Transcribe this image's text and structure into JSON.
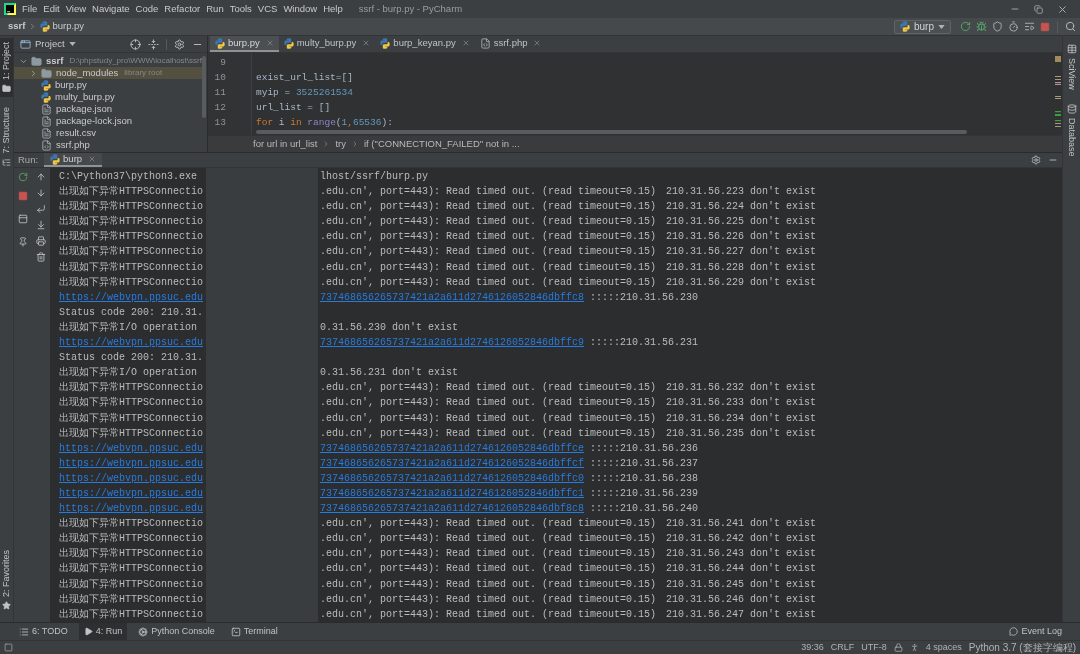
{
  "window": {
    "title": "ssrf - burp.py - PyCharm"
  },
  "menu": [
    "File",
    "Edit",
    "View",
    "Navigate",
    "Code",
    "Refactor",
    "Run",
    "Tools",
    "VCS",
    "Window",
    "Help"
  ],
  "navigation_bar": {
    "breadcrumbs": [
      {
        "label": "ssrf",
        "kind": "project"
      },
      {
        "label": "burp.py",
        "kind": "python"
      }
    ],
    "run_configuration": {
      "label": "burp",
      "kind": "python"
    }
  },
  "left_stripe": {
    "top": [
      {
        "label": "1: Project",
        "kind": "project",
        "selected": true
      },
      {
        "label": "7: Structure",
        "kind": "structure",
        "selected": false
      }
    ],
    "bottom": [
      {
        "label": "2: Favorites",
        "kind": "favorites",
        "selected": false
      }
    ]
  },
  "right_stripe": [
    {
      "label": "SciView",
      "kind": "sciview"
    },
    {
      "label": "Database",
      "kind": "database"
    }
  ],
  "project_panel": {
    "title": "Project",
    "tree": [
      {
        "label": "ssrf",
        "hint": "D:\\phpstudy_pro\\WWW\\localhost\\ssrf",
        "kind": "folder",
        "expanded": true,
        "selected": false,
        "children": [
          {
            "label": "node_modules",
            "hint": "library root",
            "kind": "folder",
            "expanded": false,
            "selected": true
          },
          {
            "label": "burp.py",
            "kind": "python",
            "selected": false
          },
          {
            "label": "multy_burp.py",
            "kind": "python",
            "selected": false
          },
          {
            "label": "package.json",
            "kind": "json",
            "selected": false
          },
          {
            "label": "package-lock.json",
            "kind": "json",
            "selected": false
          },
          {
            "label": "result.csv",
            "kind": "csv",
            "selected": false
          },
          {
            "label": "ssrf.php",
            "kind": "php",
            "selected": false
          }
        ]
      }
    ]
  },
  "editor": {
    "tabs": [
      {
        "label": "burp.py",
        "kind": "python",
        "selected": true
      },
      {
        "label": "multy_burp.py",
        "kind": "python",
        "selected": false
      },
      {
        "label": "burp_keyan.py",
        "kind": "python",
        "selected": false
      },
      {
        "label": "ssrf.php",
        "kind": "php",
        "selected": false
      }
    ],
    "lines": [
      {
        "number": "9"
      },
      {
        "number": "10",
        "tokens": [
          {
            "text": "exist_url_list=[]",
            "kind": "plain"
          }
        ]
      },
      {
        "number": "11",
        "tokens": [
          {
            "text": "myip = ",
            "kind": "plain"
          },
          {
            "text": "3525261534",
            "kind": "number"
          }
        ]
      },
      {
        "number": "12",
        "tokens": [
          {
            "text": "url_list = []",
            "kind": "plain"
          }
        ]
      },
      {
        "number": "13",
        "tokens": [
          {
            "text": "for",
            "kind": "keyword"
          },
          {
            "text": " i ",
            "kind": "plain"
          },
          {
            "text": "in",
            "kind": "keyword"
          },
          {
            "text": " range",
            "kind": "builtin"
          },
          {
            "text": "(",
            "kind": "plain"
          },
          {
            "text": "1",
            "kind": "number"
          },
          {
            "text": ",",
            "kind": "operator"
          },
          {
            "text": "65536",
            "kind": "number"
          },
          {
            "text": "):",
            "kind": "plain"
          }
        ]
      }
    ],
    "breadcrumbs": [
      "for url in url_list",
      "try",
      "if (\"CONNECTION_FAILED\" not in ..."
    ]
  },
  "run_panel": {
    "label": "Run:",
    "tabs": [
      {
        "label": "burp",
        "kind": "python",
        "selected": true
      }
    ],
    "console": [
      {
        "kind": "command",
        "left": "C:\\Python37\\python3.exe",
        "right": "lhost/ssrf/burp.py"
      },
      {
        "kind": "exception",
        "left": "出现如下异常HTTPSConnectio",
        "right": ".edu.cn', port=443): Read timed out. (read timeout=0.15)",
        "result": "210.31.56.223 don't exist"
      },
      {
        "kind": "exception",
        "left": "出现如下异常HTTPSConnectio",
        "right": ".edu.cn', port=443): Read timed out. (read timeout=0.15)",
        "result": "210.31.56.224 don't exist"
      },
      {
        "kind": "exception",
        "left": "出现如下异常HTTPSConnectio",
        "right": ".edu.cn', port=443): Read timed out. (read timeout=0.15)",
        "result": "210.31.56.225 don't exist"
      },
      {
        "kind": "exception",
        "left": "出现如下异常HTTPSConnectio",
        "right": ".edu.cn', port=443): Read timed out. (read timeout=0.15)",
        "result": "210.31.56.226 don't exist"
      },
      {
        "kind": "exception",
        "left": "出现如下异常HTTPSConnectio",
        "right": ".edu.cn', port=443): Read timed out. (read timeout=0.15)",
        "result": "210.31.56.227 don't exist"
      },
      {
        "kind": "exception",
        "left": "出现如下异常HTTPSConnectio",
        "right": ".edu.cn', port=443): Read timed out. (read timeout=0.15)",
        "result": "210.31.56.228 don't exist"
      },
      {
        "kind": "exception",
        "left": "出现如下异常HTTPSConnectio",
        "right": ".edu.cn', port=443): Read timed out. (read timeout=0.15)",
        "result": "210.31.56.229 don't exist"
      },
      {
        "kind": "link",
        "left": "https://webvpn.ppsuc.edu",
        "right": "737468656265737421a2a611d2746126052846dbffc8",
        "result": ":::::210.31.56.230"
      },
      {
        "kind": "status",
        "left": "Status code 200: 210.31."
      },
      {
        "kind": "io_error",
        "left": "出现如下异常I/O operation",
        "right": "0.31.56.230 don't exist"
      },
      {
        "kind": "link",
        "left": "https://webvpn.ppsuc.edu",
        "right": "737468656265737421a2a611d2746126052846dbffc9",
        "result": ":::::210.31.56.231"
      },
      {
        "kind": "status",
        "left": "Status code 200: 210.31."
      },
      {
        "kind": "io_error",
        "left": "出现如下异常I/O operation",
        "right": "0.31.56.231 don't exist"
      },
      {
        "kind": "exception",
        "left": "出现如下异常HTTPSConnectio",
        "right": ".edu.cn', port=443): Read timed out. (read timeout=0.15)",
        "result": "210.31.56.232 don't exist"
      },
      {
        "kind": "exception",
        "left": "出现如下异常HTTPSConnectio",
        "right": ".edu.cn', port=443): Read timed out. (read timeout=0.15)",
        "result": "210.31.56.233 don't exist"
      },
      {
        "kind": "exception",
        "left": "出现如下异常HTTPSConnectio",
        "right": ".edu.cn', port=443): Read timed out. (read timeout=0.15)",
        "result": "210.31.56.234 don't exist"
      },
      {
        "kind": "exception",
        "left": "出现如下异常HTTPSConnectio",
        "right": ".edu.cn', port=443): Read timed out. (read timeout=0.15)",
        "result": "210.31.56.235 don't exist"
      },
      {
        "kind": "link",
        "left": "https://webvpn.ppsuc.edu",
        "right": "737468656265737421a2a611d2746126052846dbffce",
        "result": ":::::210.31.56.236"
      },
      {
        "kind": "link",
        "left": "https://webvpn.ppsuc.edu",
        "right": "737468656265737421a2a611d2746126052846dbffcf",
        "result": ":::::210.31.56.237"
      },
      {
        "kind": "link",
        "left": "https://webvpn.ppsuc.edu",
        "right": "737468656265737421a2a611d2746126052846dbffc0",
        "result": ":::::210.31.56.238"
      },
      {
        "kind": "link",
        "left": "https://webvpn.ppsuc.edu",
        "right": "737468656265737421a2a611d2746126052846dbffc1",
        "result": ":::::210.31.56.239"
      },
      {
        "kind": "link",
        "left": "https://webvpn.ppsuc.edu",
        "right": "737468656265737421a2a611d2746126052846dbf8c8",
        "result": ":::::210.31.56.240"
      },
      {
        "kind": "exception",
        "left": "出现如下异常HTTPSConnectio",
        "right": ".edu.cn', port=443): Read timed out. (read timeout=0.15)",
        "result": "210.31.56.241 don't exist"
      },
      {
        "kind": "exception",
        "left": "出现如下异常HTTPSConnectio",
        "right": ".edu.cn', port=443): Read timed out. (read timeout=0.15)",
        "result": "210.31.56.242 don't exist"
      },
      {
        "kind": "exception",
        "left": "出现如下异常HTTPSConnectio",
        "right": ".edu.cn', port=443): Read timed out. (read timeout=0.15)",
        "result": "210.31.56.243 don't exist"
      },
      {
        "kind": "exception",
        "left": "出现如下异常HTTPSConnectio",
        "right": ".edu.cn', port=443): Read timed out. (read timeout=0.15)",
        "result": "210.31.56.244 don't exist"
      },
      {
        "kind": "exception",
        "left": "出现如下异常HTTPSConnectio",
        "right": ".edu.cn', port=443): Read timed out. (read timeout=0.15)",
        "result": "210.31.56.245 don't exist"
      },
      {
        "kind": "exception",
        "left": "出现如下异常HTTPSConnectio",
        "right": ".edu.cn', port=443): Read timed out. (read timeout=0.15)",
        "result": "210.31.56.246 don't exist"
      },
      {
        "kind": "exception",
        "left": "出现如下异常HTTPSConnectio",
        "right": ".edu.cn', port=443): Read timed out. (read timeout=0.15)",
        "result": "210.31.56.247 don't exist"
      }
    ]
  },
  "bottom_bar": {
    "tabs": [
      {
        "label": "6: TODO",
        "kind": "todo",
        "selected": false
      },
      {
        "label": "4: Run",
        "kind": "run",
        "selected": true
      },
      {
        "label": "Python Console",
        "kind": "console",
        "selected": false
      },
      {
        "label": "Terminal",
        "kind": "terminal",
        "selected": false
      }
    ],
    "event_log": "Event Log"
  },
  "status_bar": {
    "position": "39:36",
    "line_separator": "CRLF",
    "encoding": "UTF-8",
    "indent": "4 spaces",
    "interpreter": "Python 3.7 (套接字编程)"
  }
}
